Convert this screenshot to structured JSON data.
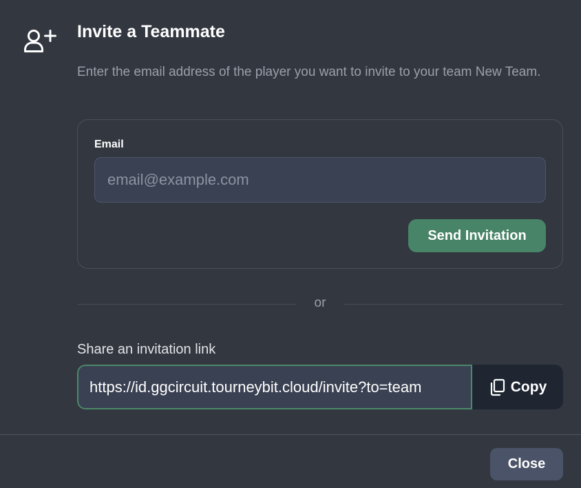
{
  "dialog": {
    "title": "Invite a Teammate",
    "description": "Enter the email address of the player you want to invite to your team New Team.",
    "header_icon": "user-plus-icon"
  },
  "email_form": {
    "label": "Email",
    "placeholder": "email@example.com",
    "value": "",
    "send_label": "Send Invitation"
  },
  "divider": {
    "text": "or"
  },
  "share": {
    "label": "Share an invitation link",
    "link_value": "https://id.ggcircuit.tourneybit.cloud/invite?to=team",
    "copy_label": "Copy",
    "copy_icon": "copy-icon"
  },
  "footer": {
    "close_label": "Close"
  },
  "colors": {
    "background": "#333740",
    "accent": "#488468",
    "input_bg": "#3a4152",
    "copy_bg": "#1f2631",
    "close_bg": "#4a5367"
  }
}
